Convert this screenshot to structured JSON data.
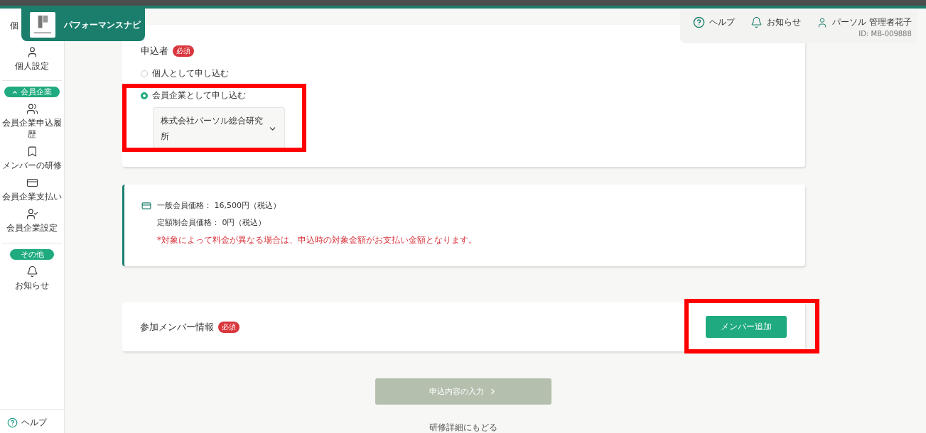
{
  "brand": {
    "name": "パフォーマンスナビ"
  },
  "header": {
    "help": "ヘルプ",
    "notices": "お知らせ",
    "user": "パーソル 管理者花子",
    "user_id": "ID: MB-009888"
  },
  "sidebar": {
    "cut_label": "個",
    "items": [
      {
        "kind": "item",
        "label": "個人設定"
      },
      {
        "kind": "section",
        "label": "会員企業",
        "expanded": true
      },
      {
        "kind": "item",
        "label": "会員企業申込履歴"
      },
      {
        "kind": "item",
        "label": "メンバーの研修"
      },
      {
        "kind": "item",
        "label": "会員企業支払い"
      },
      {
        "kind": "item",
        "label": "会員企業設定"
      },
      {
        "kind": "section",
        "label": "その他"
      },
      {
        "kind": "item",
        "label": "お知らせ"
      }
    ],
    "help": "ヘルプ"
  },
  "applicant": {
    "title": "申込者",
    "badge": "必須",
    "options": [
      {
        "label": "個人として申し込む",
        "selected": false
      },
      {
        "label": "会員企業として申し込む",
        "selected": true,
        "highlighted": true
      }
    ],
    "company_select": {
      "value": "株式会社パーソル総合研究所"
    }
  },
  "price": {
    "lines": [
      "一般会員価格： 16,500円（税込）",
      "定額制会員価格： 0円（税込）"
    ],
    "note": "*対象によって料金が異なる場合は、申込時の対象金額がお支払い金額となります。"
  },
  "members": {
    "title": "参加メンバー情報",
    "badge": "必須",
    "add_button": {
      "label": "メンバー追加",
      "highlighted": true
    }
  },
  "next_button": {
    "label": "申込内容の入力",
    "disabled": true
  },
  "back_link": "研修詳細にもどる"
}
